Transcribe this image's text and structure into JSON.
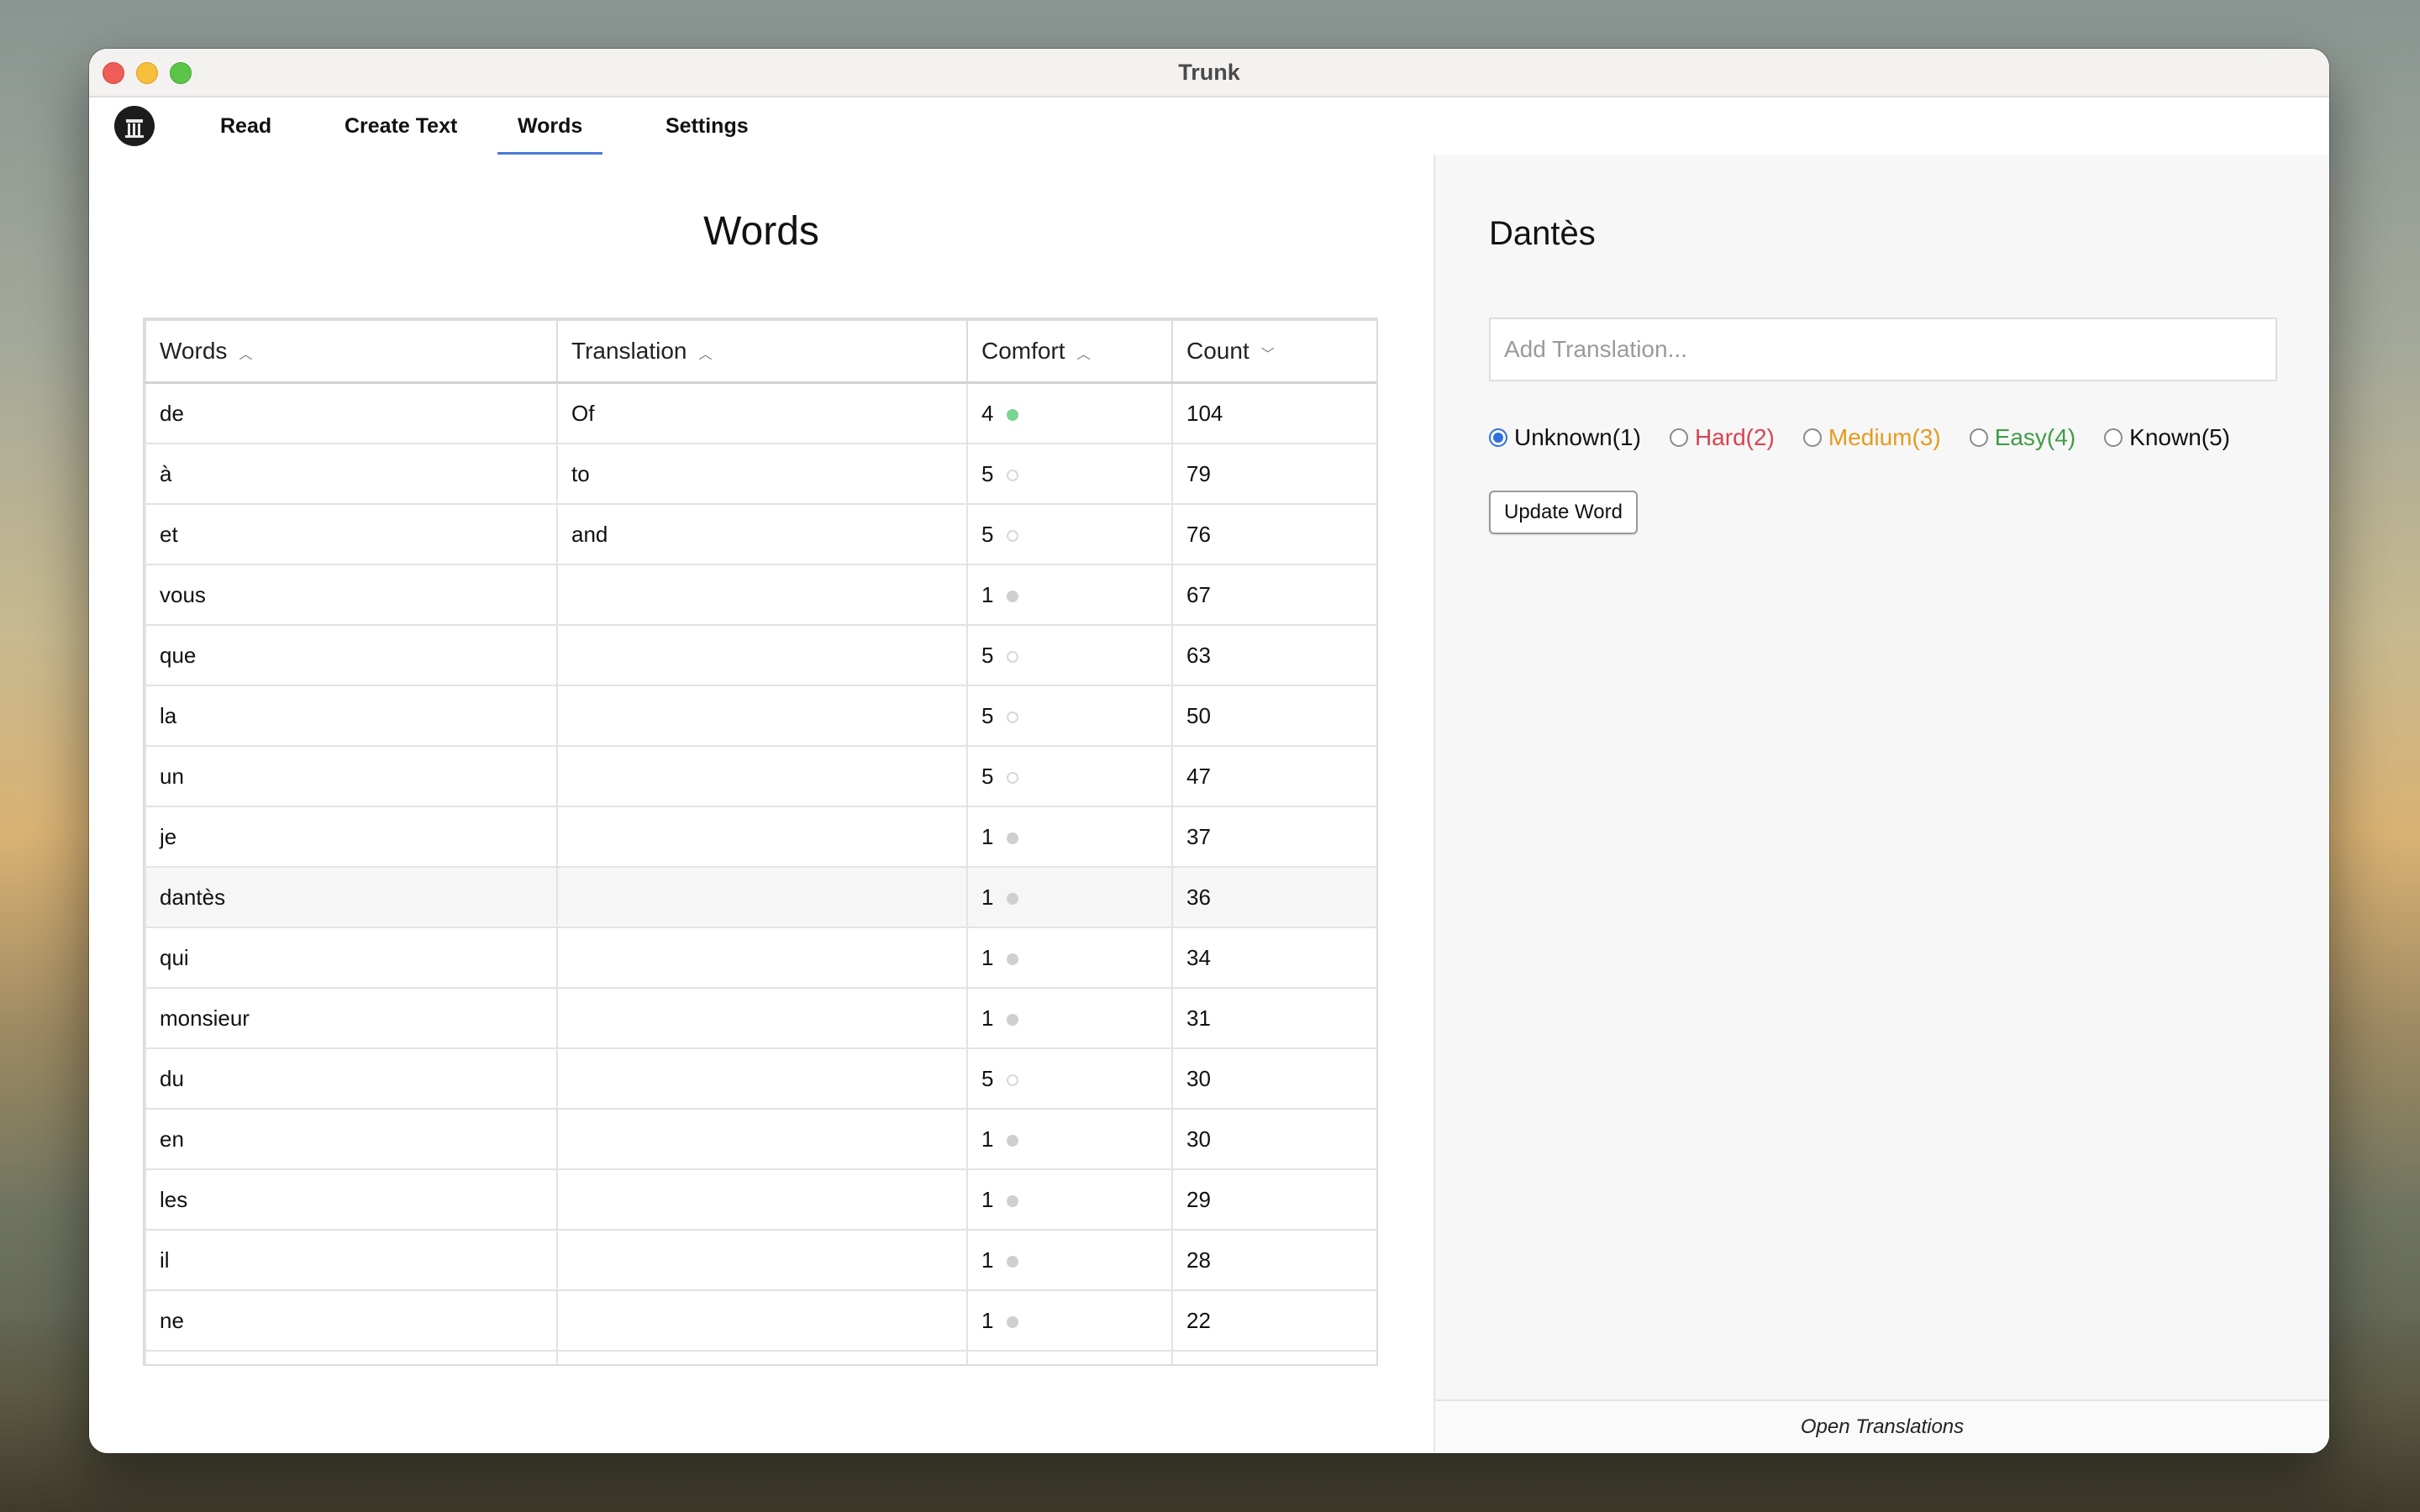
{
  "window": {
    "title": "Trunk"
  },
  "nav": {
    "tabs": [
      {
        "label": "Read"
      },
      {
        "label": "Create Text"
      },
      {
        "label": "Words"
      },
      {
        "label": "Settings"
      }
    ],
    "active_tab": "Words"
  },
  "main": {
    "title": "Words",
    "table": {
      "headers": [
        {
          "label": "Words",
          "sort": "asc"
        },
        {
          "label": "Translation",
          "sort": "asc"
        },
        {
          "label": "Comfort",
          "sort": "asc"
        },
        {
          "label": "Count",
          "sort": "desc"
        }
      ],
      "rows": [
        {
          "word": "de",
          "translation": "Of",
          "comfort": "4",
          "status": "easy",
          "count": "104"
        },
        {
          "word": "à",
          "translation": "to",
          "comfort": "5",
          "status": "known",
          "count": "79"
        },
        {
          "word": "et",
          "translation": "and",
          "comfort": "5",
          "status": "known",
          "count": "76"
        },
        {
          "word": "vous",
          "translation": "",
          "comfort": "1",
          "status": "unknown",
          "count": "67"
        },
        {
          "word": "que",
          "translation": "",
          "comfort": "5",
          "status": "known",
          "count": "63"
        },
        {
          "word": "la",
          "translation": "",
          "comfort": "5",
          "status": "known",
          "count": "50"
        },
        {
          "word": "un",
          "translation": "",
          "comfort": "5",
          "status": "known",
          "count": "47"
        },
        {
          "word": "je",
          "translation": "",
          "comfort": "1",
          "status": "unknown",
          "count": "37"
        },
        {
          "word": "dantès",
          "translation": "",
          "comfort": "1",
          "status": "unknown",
          "count": "36",
          "selected": true
        },
        {
          "word": "qui",
          "translation": "",
          "comfort": "1",
          "status": "unknown",
          "count": "34"
        },
        {
          "word": "monsieur",
          "translation": "",
          "comfort": "1",
          "status": "unknown",
          "count": "31"
        },
        {
          "word": "du",
          "translation": "",
          "comfort": "5",
          "status": "known",
          "count": "30"
        },
        {
          "word": "en",
          "translation": "",
          "comfort": "1",
          "status": "unknown",
          "count": "30"
        },
        {
          "word": "les",
          "translation": "",
          "comfort": "1",
          "status": "unknown",
          "count": "29"
        },
        {
          "word": "il",
          "translation": "",
          "comfort": "1",
          "status": "unknown",
          "count": "28"
        },
        {
          "word": "ne",
          "translation": "",
          "comfort": "1",
          "status": "unknown",
          "count": "22"
        },
        {
          "word": "",
          "translation": "",
          "comfort": "",
          "status": "",
          "count": ""
        }
      ]
    }
  },
  "detail": {
    "word": "Dantès",
    "translation_placeholder": "Add Translation...",
    "translation_value": "",
    "levels": [
      {
        "label": "Unknown(1)",
        "color": "#111111",
        "checked": true
      },
      {
        "label": "Hard(2)",
        "color": "#d9434f",
        "checked": false
      },
      {
        "label": "Medium(3)",
        "color": "#e69a1f",
        "checked": false
      },
      {
        "label": "Easy(4)",
        "color": "#3f9c46",
        "checked": false
      },
      {
        "label": "Known(5)",
        "color": "#111111",
        "checked": false
      }
    ],
    "update_button": "Update Word",
    "footer_link": "Open Translations"
  },
  "colors": {
    "accent": "#4a7ad6",
    "radio_checked": "#2f6fe0",
    "easy_dot": "#7ad491",
    "unknown_dot": "#cfcfcf"
  }
}
